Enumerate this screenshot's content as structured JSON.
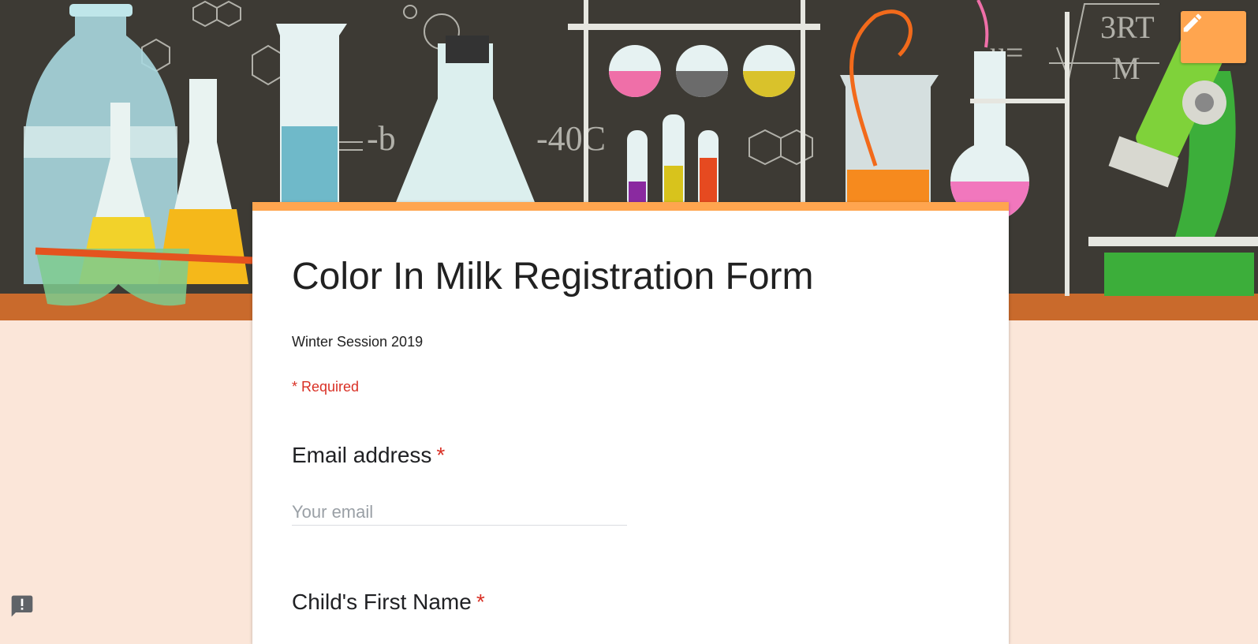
{
  "form": {
    "title": "Color In Milk Registration Form",
    "description": "Winter Session 2019",
    "required_note": "* Required",
    "questions": [
      {
        "label": "Email address",
        "required_mark": "*",
        "placeholder": "Your email",
        "value": ""
      },
      {
        "label": "Child's First Name",
        "required_mark": "*"
      }
    ]
  },
  "header": {
    "edit_icon": "pencil-icon",
    "image": "chemistry-lab-banner"
  },
  "footer": {
    "report_icon": "report-issue-icon"
  },
  "colors": {
    "accent": "#ffa54f",
    "background": "#fbe6d9",
    "required": "#d93025",
    "banner_dark": "#3d3a34"
  }
}
